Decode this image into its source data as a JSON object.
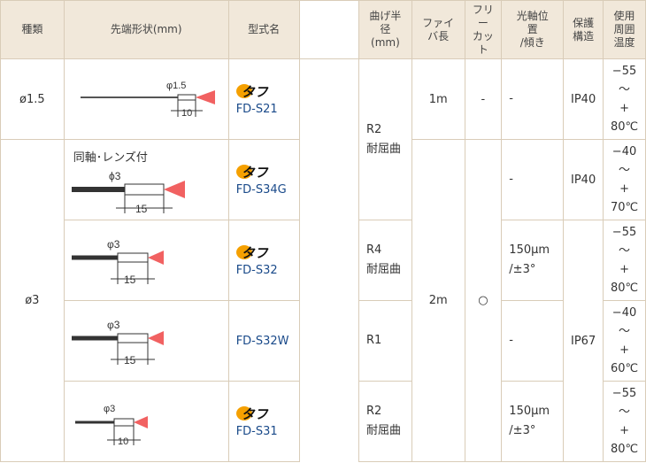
{
  "headers": {
    "type": "種類",
    "tip_shape": "先端形状(mm)",
    "model": "型式名",
    "bend_radius": [
      "曲げ半",
      "径",
      "(mm)"
    ],
    "fiber_length": [
      "ファイ",
      "バ長"
    ],
    "free_cut": [
      "フリ",
      "ー",
      "カッ",
      "ト"
    ],
    "optical_axis": [
      "光軸位",
      "置",
      "/傾き"
    ],
    "protection": [
      "保護",
      "構造"
    ],
    "temp_range": [
      "使用",
      "周囲",
      "温度"
    ]
  },
  "logo_text": "タフ",
  "rows": [
    {
      "type": "ø1.5",
      "diameter_label": "φ1.5",
      "dimension": "10",
      "model": "FD-S21",
      "fiber_length": "1m",
      "free_cut": "-",
      "optical_axis": "-",
      "protection": "IP40",
      "temp": [
        "−55",
        "〜",
        "+",
        "80℃"
      ]
    },
    {
      "type": "ø3",
      "note": "同軸･レンズ付",
      "diameter_label": "ϕ3",
      "dimension": "15",
      "model": "FD-S34G",
      "optical_axis": "-",
      "protection": "IP40",
      "temp": [
        "−40",
        "〜",
        "+",
        "70℃"
      ]
    },
    {
      "diameter_label": "φ3",
      "dimension": "15",
      "model": "FD-S32",
      "bend": [
        "R4",
        "耐屈曲"
      ],
      "optical_axis": [
        "150μm",
        "/±3°"
      ],
      "temp": [
        "−55",
        "〜",
        "+",
        "80℃"
      ]
    },
    {
      "diameter_label": "φ3",
      "dimension": "15",
      "model": "FD-S32W",
      "bend": [
        "R1"
      ],
      "fiber_length": "2m",
      "free_cut": "○",
      "optical_axis": "-",
      "protection": "IP67",
      "temp": [
        "−40",
        "〜",
        "+",
        "60℃"
      ]
    },
    {
      "diameter_label": "φ3",
      "dimension": "10",
      "model": "FD-S31",
      "bend": [
        "R2",
        "耐屈曲"
      ],
      "optical_axis": [
        "150μm",
        "/±3°"
      ],
      "temp": [
        "−55",
        "〜",
        "+",
        "80℃"
      ]
    }
  ],
  "bend_r2": [
    "R2",
    "耐屈曲"
  ]
}
